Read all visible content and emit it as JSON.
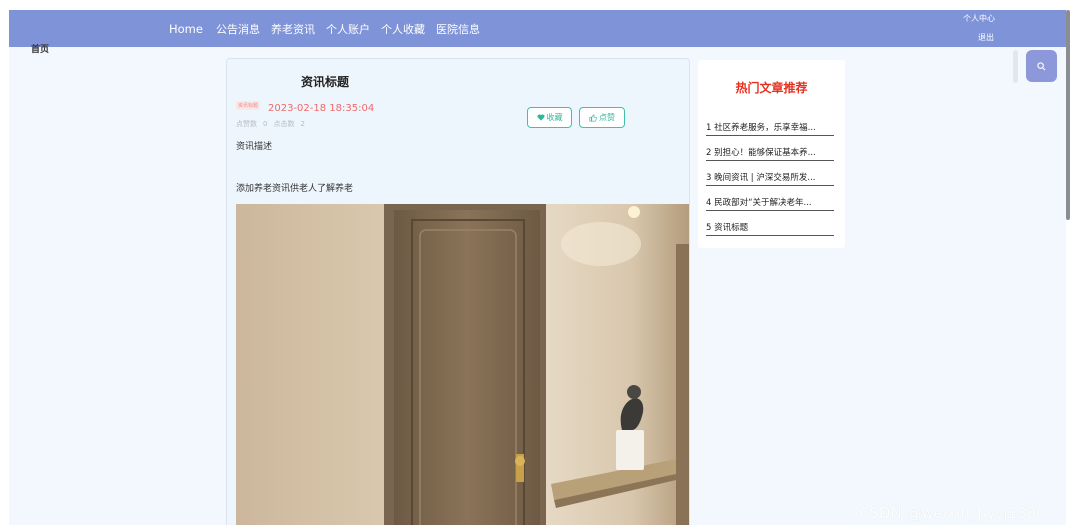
{
  "nav": {
    "items": [
      "Home",
      "公告消息",
      "养老资讯",
      "个人账户",
      "个人收藏",
      "医院信息"
    ],
    "user_center": "个人中心",
    "logout": "退出"
  },
  "logo_text": "首页",
  "colors": {
    "topbar": "#7f93d9",
    "accent_button": "#3cc3a9",
    "date_red": "#f06b6b",
    "hot_title_red": "#e8301f",
    "search_button": "#8c98da"
  },
  "search": {
    "icon": "search-icon"
  },
  "article": {
    "title": "资讯标题",
    "tag": "资讯标题",
    "date": "2023-02-18 18:35:04",
    "likes_label": "点赞数",
    "likes_value": "0",
    "clicks_label": "点击数",
    "clicks_value": "2",
    "collect_button": "收藏",
    "like_button": "点赞",
    "description_label": "资讯描述",
    "content": "添加养老资讯供老人了解养老"
  },
  "hot": {
    "title": "热门文章推荐",
    "items": [
      "1 社区养老服务，乐享幸福...",
      "2 别担心！能够保证基本养...",
      "3 晚间资讯 | 沪深交易所发...",
      "4 民政部对“关于解决老年...",
      "5 资讯标题"
    ]
  },
  "watermark": "CSDN @weixin_bysj1330"
}
